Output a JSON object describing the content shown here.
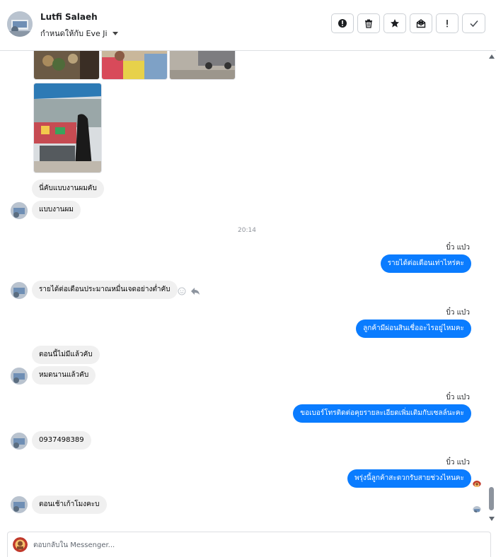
{
  "header": {
    "contact_name": "Lutfi Salaeh",
    "assign_label": "กำหนดให้กับ Eve Ji"
  },
  "toolbar": {
    "icons": [
      "alert-circle-icon",
      "trash-icon",
      "star-icon",
      "mail-icon",
      "exclamation-icon",
      "check-icon"
    ]
  },
  "messages": {
    "in_1": "นี่คับแบบงานผมคับ",
    "in_2": "แบบงานผม",
    "time_1": "20:14",
    "sender_1": "บิ๋ว แบ๋ว",
    "out_1": "รายได้ต่อเดือนเท่าไหร่คะ",
    "in_3": "รายได้ต่อเดือนประมาณหมื่นเจดอย่างต่ำคับ",
    "sender_2": "บิ๋ว แบ๋ว",
    "out_2": "ลูกค้ามีผ่อนสินเชื่ออะไรอยู่ไหมคะ",
    "in_4": "ตอนนี้ไม่มีแล้วคับ",
    "in_5": "หมดนานแล้วคับ",
    "sender_3": "บิ๋ว แบ๋ว",
    "out_3": "ขอเบอร์โทรติดต่อคุยรายละเอียดเพิ่มเติมกับเซลล์นะคะ",
    "in_6": "0937498389",
    "sender_4": "บิ๋ว แบ๋ว",
    "out_4": "พรุ่งนี้ลูกค้าสะดวกรับสายช่วงไหนคะ",
    "in_7": "ตอนเช้าเก้าโมงคะบ"
  },
  "reply": {
    "placeholder": "ตอบกลับใน Messenger..."
  },
  "colors": {
    "outgoing_bubble": "#0a7cff",
    "incoming_bubble": "#f0f0f0"
  }
}
